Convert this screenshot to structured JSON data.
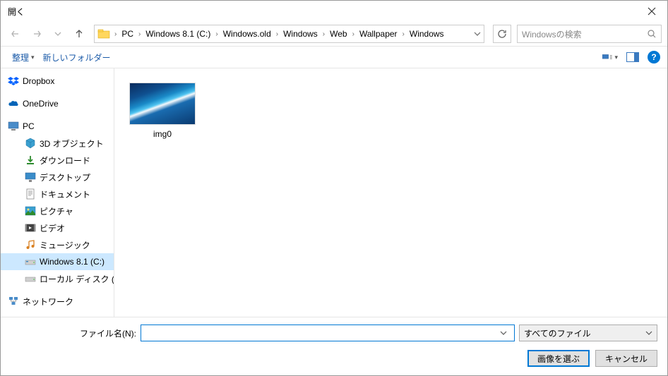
{
  "window": {
    "title": "開く"
  },
  "breadcrumbs": [
    "PC",
    "Windows 8.1 (C:)",
    "Windows.old",
    "Windows",
    "Web",
    "Wallpaper",
    "Windows"
  ],
  "search": {
    "placeholder": "Windowsの検索"
  },
  "toolbar": {
    "organize": "整理",
    "new_folder": "新しいフォルダー"
  },
  "sidebar": {
    "items": [
      {
        "label": "Dropbox",
        "icon": "dropbox",
        "inset": false
      },
      {
        "label": "OneDrive",
        "icon": "onedrive",
        "inset": false
      },
      {
        "label": "PC",
        "icon": "pc",
        "inset": false
      },
      {
        "label": "3D オブジェクト",
        "icon": "3d",
        "inset": true
      },
      {
        "label": "ダウンロード",
        "icon": "download",
        "inset": true
      },
      {
        "label": "デスクトップ",
        "icon": "desktop",
        "inset": true
      },
      {
        "label": "ドキュメント",
        "icon": "document",
        "inset": true
      },
      {
        "label": "ピクチャ",
        "icon": "picture",
        "inset": true
      },
      {
        "label": "ビデオ",
        "icon": "video",
        "inset": true
      },
      {
        "label": "ミュージック",
        "icon": "music",
        "inset": true
      },
      {
        "label": "Windows 8.1 (C:)",
        "icon": "drive",
        "inset": true,
        "selected": true
      },
      {
        "label": "ローカル ディスク (D:)",
        "icon": "drive",
        "inset": true
      },
      {
        "label": "ネットワーク",
        "icon": "network",
        "inset": false
      }
    ]
  },
  "files": [
    {
      "name": "img0",
      "type": "image"
    }
  ],
  "footer": {
    "filename_label": "ファイル名(N):",
    "filename_value": "",
    "filter": "すべてのファイル",
    "open_label": "画像を選ぶ",
    "cancel_label": "キャンセル"
  }
}
